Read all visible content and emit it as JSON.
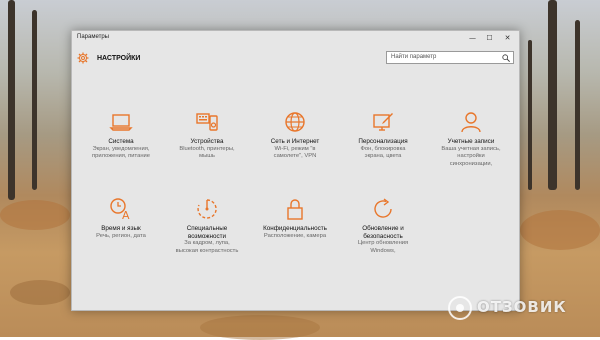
{
  "window": {
    "title": "Параметры",
    "minimize": "—",
    "maximize": "☐",
    "close": "✕"
  },
  "header": {
    "title": "НАСТРОЙКИ",
    "search_placeholder": "Найти параметр"
  },
  "tiles": [
    {
      "name": "Система",
      "desc": [
        "Экран, уведомления,",
        "приложения, питание"
      ],
      "icon": "laptop-icon"
    },
    {
      "name": "Устройства",
      "desc": [
        "Bluetooth, принтеры,",
        "мышь"
      ],
      "icon": "devices-icon"
    },
    {
      "name": "Сеть и Интернет",
      "desc": [
        "Wi-Fi, режим \"в",
        "самолете\", VPN"
      ],
      "icon": "globe-icon"
    },
    {
      "name": "Персонализация",
      "desc": [
        "Фон, блокировка",
        "экрана, цвета"
      ],
      "icon": "personalization-icon"
    },
    {
      "name": "Учетные записи",
      "desc": [
        "Ваша учетная запись,",
        "настройки",
        "синхронизации,"
      ],
      "icon": "person-icon"
    },
    {
      "name": "Время и язык",
      "desc": [
        "Речь, регион, дата"
      ],
      "icon": "time-language-icon"
    },
    {
      "name": "Специальные",
      "name2": "возможности",
      "desc": [
        "За кадром, лупа,",
        "высокая контрастность"
      ],
      "icon": "accessibility-icon"
    },
    {
      "name": "Конфиденциальность",
      "desc": [
        "Расположение, камера"
      ],
      "icon": "lock-icon"
    },
    {
      "name": "Обновление и",
      "name2": "безопасность",
      "desc": [
        "Центр обновления",
        "Windows,"
      ],
      "icon": "update-icon"
    }
  ],
  "watermark": {
    "text": "ОТЗОВИК"
  },
  "colors": {
    "accent": "#e8762b",
    "window_bg": "#e6e6e6"
  }
}
